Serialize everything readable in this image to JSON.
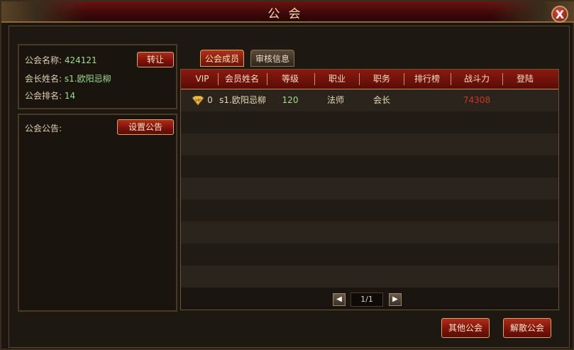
{
  "window": {
    "title": "公会",
    "close_glyph": "X"
  },
  "guild_info": {
    "name_label": "公会名称:",
    "name_value": "424121",
    "leader_label": "会长姓名:",
    "leader_value": "s1.欧阳忌柳",
    "rank_label": "公会排名:",
    "rank_value": "14",
    "transfer_button": "转让"
  },
  "notice": {
    "label": "公会公告:",
    "set_button": "设置公告"
  },
  "tabs": [
    {
      "label": "公会成员",
      "active": true
    },
    {
      "label": "审核信息",
      "active": false
    }
  ],
  "table": {
    "headers": [
      "VIP",
      "会员姓名",
      "等级",
      "职业",
      "职务",
      "排行榜",
      "战斗力",
      "登陆"
    ],
    "rows": [
      {
        "vip": "0",
        "name": "s1.欧阳忌柳",
        "level": "120",
        "class": "法师",
        "position": "会长",
        "rank": "",
        "power": "74308",
        "login": ""
      }
    ]
  },
  "pager": {
    "prev_icon": "◀",
    "next_icon": "▶",
    "page": "1/1"
  },
  "footer": {
    "other_guilds_button": "其他公会",
    "disband_button": "解散公会"
  },
  "colors": {
    "accent_red": "#7a1208",
    "gold_border": "#d8a860",
    "green_value": "#9be08a",
    "power_red": "#d83020"
  }
}
